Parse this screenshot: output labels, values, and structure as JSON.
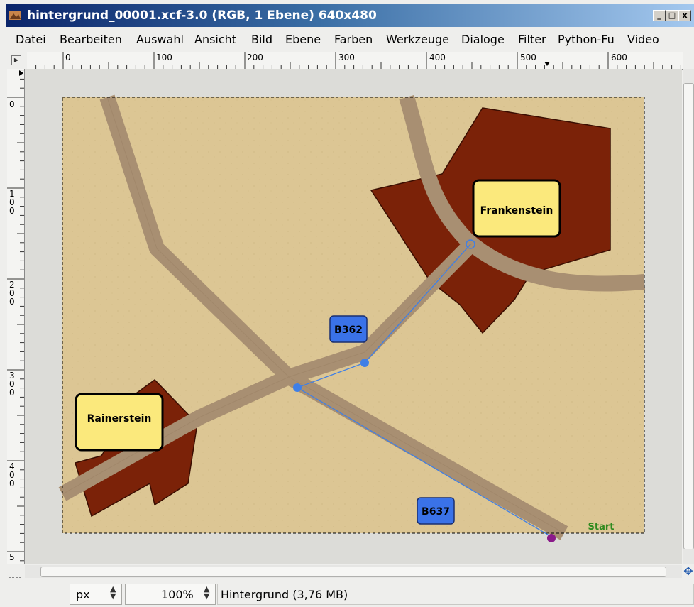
{
  "window": {
    "title": "hintergrund_00001.xcf-3.0 (RGB, 1 Ebene) 640x480",
    "minimize": "_",
    "maximize": "□",
    "close": "x"
  },
  "menubar": [
    {
      "label": "Datei"
    },
    {
      "label": "Bearbeiten"
    },
    {
      "label": "Auswahl"
    },
    {
      "label": "Ansicht"
    },
    {
      "label": "Bild"
    },
    {
      "label": "Ebene"
    },
    {
      "label": "Farben"
    },
    {
      "label": "Werkzeuge"
    },
    {
      "label": "Dialoge"
    },
    {
      "label": "Filter"
    },
    {
      "label": "Python-Fu"
    },
    {
      "label": "Video"
    }
  ],
  "rulers": {
    "horizontal": [
      "0",
      "100",
      "200",
      "300",
      "400",
      "500",
      "600"
    ],
    "vertical": [
      "0",
      "100",
      "200",
      "300",
      "400",
      "5"
    ]
  },
  "map": {
    "towns": [
      {
        "name": "Frankenstein"
      },
      {
        "name": "Rainerstein"
      }
    ],
    "road_signs": [
      {
        "label": "B362"
      },
      {
        "label": "B637"
      }
    ],
    "start_label": "Start",
    "colors": {
      "background": "#dcc694",
      "road": "#a88f72",
      "town_area": "#7b2208",
      "town_label": "#fbe97c",
      "sign": "#3a72e8",
      "path": "#3f7fe6",
      "start": "#2f8a1f"
    }
  },
  "status": {
    "unit": "px",
    "zoom": "100%",
    "layer_info": "Hintergrund (3,76 MB)"
  }
}
